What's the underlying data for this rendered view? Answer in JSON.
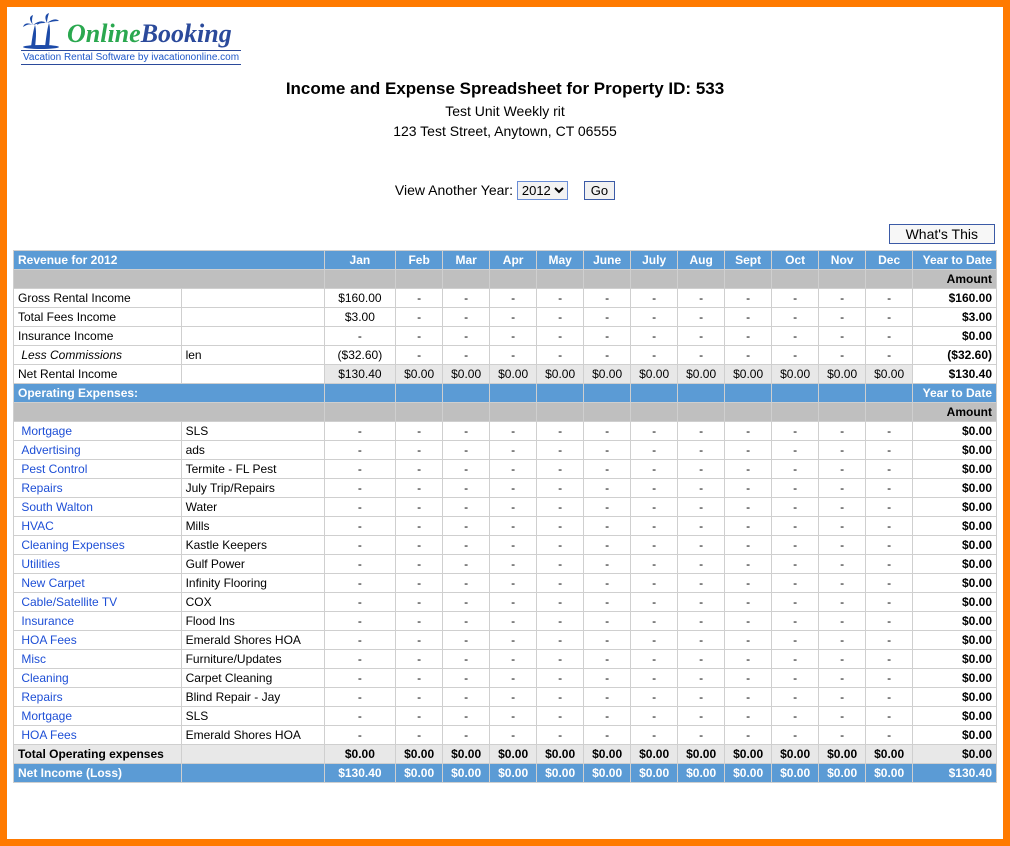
{
  "logo": {
    "brand1": "Online",
    "brand2": "Booking",
    "tagline": "Vacation Rental Software by ivacationonline.com"
  },
  "header": {
    "title": "Income and Expense Spreadsheet for Property ID: 533",
    "unit": "Test Unit Weekly rit",
    "address": "123 Test Street, Anytown, CT 06555"
  },
  "controls": {
    "view_label": "View Another Year:",
    "year_value": "2012",
    "go_label": "Go",
    "whats_this": "What's This"
  },
  "columns": {
    "revenue_header": "Revenue for 2012",
    "months": [
      "Jan",
      "Feb",
      "Mar",
      "Apr",
      "May",
      "June",
      "July",
      "Aug",
      "Sept",
      "Oct",
      "Nov",
      "Dec"
    ],
    "ytd": "Year to Date",
    "amount": "Amount"
  },
  "revenue": {
    "rows": [
      {
        "label": "Gross Rental Income",
        "sub": "",
        "cells": [
          "$160.00",
          "-",
          "-",
          "-",
          "-",
          "-",
          "-",
          "-",
          "-",
          "-",
          "-",
          "-"
        ],
        "ytd": "$160.00"
      },
      {
        "label": "Total Fees Income",
        "sub": "",
        "cells": [
          "$3.00",
          "-",
          "-",
          "-",
          "-",
          "-",
          "-",
          "-",
          "-",
          "-",
          "-",
          "-"
        ],
        "ytd": "$3.00"
      },
      {
        "label": "Insurance Income",
        "sub": "",
        "cells": [
          "-",
          "-",
          "-",
          "-",
          "-",
          "-",
          "-",
          "-",
          "-",
          "-",
          "-",
          "-"
        ],
        "ytd": "$0.00"
      },
      {
        "label": "Less Commissions",
        "sub": "len",
        "italic": true,
        "cells": [
          "($32.60)",
          "-",
          "-",
          "-",
          "-",
          "-",
          "-",
          "-",
          "-",
          "-",
          "-",
          "-"
        ],
        "ytd": "($32.60)"
      }
    ],
    "net": {
      "label": "Net Rental Income",
      "cells": [
        "$130.40",
        "$0.00",
        "$0.00",
        "$0.00",
        "$0.00",
        "$0.00",
        "$0.00",
        "$0.00",
        "$0.00",
        "$0.00",
        "$0.00",
        "$0.00"
      ],
      "ytd": "$130.40"
    }
  },
  "expenses_header": "Operating Expenses:",
  "expenses": {
    "rows": [
      {
        "label": "Mortgage",
        "sub": "SLS",
        "ytd": "$0.00"
      },
      {
        "label": "Advertising",
        "sub": "ads",
        "ytd": "$0.00"
      },
      {
        "label": "Pest Control",
        "sub": "Termite - FL Pest",
        "ytd": "$0.00"
      },
      {
        "label": "Repairs",
        "sub": "July Trip/Repairs",
        "ytd": "$0.00"
      },
      {
        "label": "South Walton",
        "sub": "Water",
        "ytd": "$0.00"
      },
      {
        "label": "HVAC",
        "sub": "Mills",
        "ytd": "$0.00"
      },
      {
        "label": "Cleaning Expenses",
        "sub": "Kastle Keepers",
        "ytd": "$0.00"
      },
      {
        "label": "Utilities",
        "sub": "Gulf Power",
        "ytd": "$0.00"
      },
      {
        "label": "New Carpet",
        "sub": "Infinity Flooring",
        "ytd": "$0.00"
      },
      {
        "label": "Cable/Satellite TV",
        "sub": "COX",
        "ytd": "$0.00"
      },
      {
        "label": "Insurance",
        "sub": "Flood Ins",
        "ytd": "$0.00"
      },
      {
        "label": "HOA Fees",
        "sub": "Emerald Shores HOA",
        "ytd": "$0.00"
      },
      {
        "label": "Misc",
        "sub": "Furniture/Updates",
        "ytd": "$0.00"
      },
      {
        "label": "Cleaning",
        "sub": "Carpet Cleaning",
        "ytd": "$0.00"
      },
      {
        "label": "Repairs",
        "sub": "Blind Repair - Jay",
        "ytd": "$0.00"
      },
      {
        "label": "Mortgage",
        "sub": "SLS",
        "ytd": "$0.00"
      },
      {
        "label": "HOA Fees",
        "sub": "Emerald Shores HOA",
        "ytd": "$0.00"
      }
    ],
    "total": {
      "label": "Total Operating expenses",
      "cells": [
        "$0.00",
        "$0.00",
        "$0.00",
        "$0.00",
        "$0.00",
        "$0.00",
        "$0.00",
        "$0.00",
        "$0.00",
        "$0.00",
        "$0.00",
        "$0.00"
      ],
      "ytd": "$0.00"
    }
  },
  "net_income": {
    "label": "Net Income (Loss)",
    "cells": [
      "$130.40",
      "$0.00",
      "$0.00",
      "$0.00",
      "$0.00",
      "$0.00",
      "$0.00",
      "$0.00",
      "$0.00",
      "$0.00",
      "$0.00",
      "$0.00"
    ],
    "ytd": "$130.40"
  }
}
